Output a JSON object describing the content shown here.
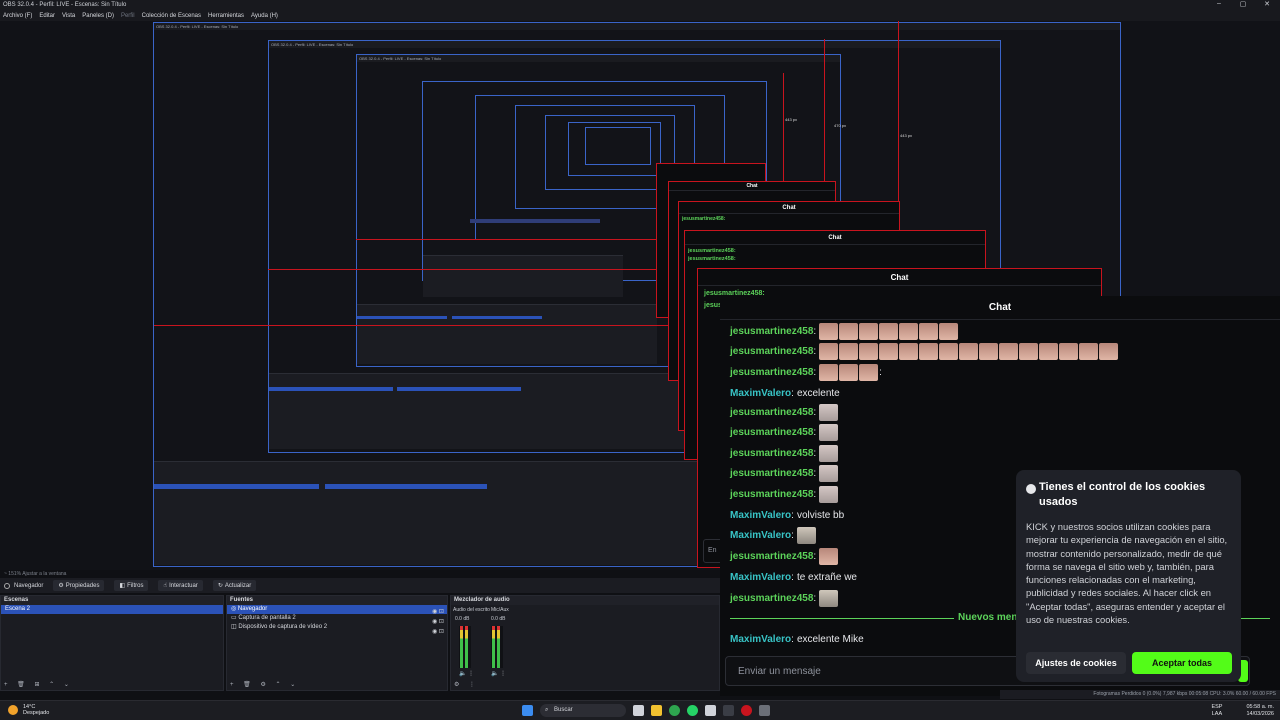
{
  "window": {
    "title": "OBS 32.0.4 - Perfil: LIVE - Escenas: Sin Título",
    "controls": [
      "–",
      "▢",
      "✕"
    ]
  },
  "menu": [
    "Archivo (F)",
    "Editar",
    "Vista",
    "Paneles (D)",
    "Perfil",
    "Colección de Escenas",
    "Herramientas",
    "Ayuda (H)"
  ],
  "preview": {
    "measure_labels": [
      "443 px",
      "470 px",
      "443 px"
    ]
  },
  "chat": {
    "title": "Chat",
    "messages": [
      {
        "user": "jesusmartinez458",
        "sep": ":",
        "emotes": 7,
        "text": ""
      },
      {
        "user": "jesusmartinez458",
        "sep": ":",
        "emotes": 15,
        "text": ""
      },
      {
        "user": "jesusmartinez458",
        "sep": ":",
        "emotes": 3,
        "text": ":"
      },
      {
        "user": "MaximValero",
        "sep": ":",
        "emotes": 0,
        "text": "excelente"
      },
      {
        "user": "jesusmartinez458",
        "sep": ":",
        "emotes": 1,
        "text": ""
      },
      {
        "user": "jesusmartinez458",
        "sep": ":",
        "emotes": 1,
        "text": ""
      },
      {
        "user": "jesusmartinez458",
        "sep": ":",
        "emotes": 1,
        "text": ""
      },
      {
        "user": "jesusmartinez458",
        "sep": ":",
        "emotes": 1,
        "text": ""
      },
      {
        "user": "jesusmartinez458",
        "sep": ":",
        "emotes": 1,
        "text": ""
      },
      {
        "user": "MaximValero",
        "sep": ":",
        "emotes": 0,
        "text": "volviste bb"
      },
      {
        "user": "MaximValero",
        "sep": ":",
        "emotes": 1,
        "text": ""
      },
      {
        "user": "jesusmartinez458",
        "sep": ":",
        "emotes": 1,
        "text": ""
      },
      {
        "user": "MaximValero",
        "sep": ":",
        "emotes": 0,
        "text": "te extrañe we"
      },
      {
        "user": "jesusmartinez458",
        "sep": ":",
        "emotes": 1,
        "text": ""
      },
      {
        "user": "MaximValero",
        "sep": ":",
        "emotes": 0,
        "text": "excelente Mike"
      }
    ],
    "new_messages_label": "Nuevos mensaje",
    "input_placeholder": "Enviar un mensaje",
    "small_input_hint": "En"
  },
  "cookie_banner": {
    "title": "Tienes el control de los cookies usados",
    "body": "KICK y nuestros socios utilizan cookies para mejorar tu experiencia de navegación en el sitio, mostrar contenido personalizado, medir de qué forma se navega el sitio web y, también, para funciones relacionadas con el marketing, publicidad y redes sociales. Al hacer click en \"Aceptar todas\", aseguras entender y aceptar el uso de nuestras cookies.",
    "settings_button": "Ajustes de cookies",
    "accept_button": "Aceptar todas"
  },
  "obs": {
    "status_line": "~  151%   Ajustar a la ventana",
    "toolbar": {
      "source_name": "Navegador",
      "buttons": [
        "Propiedades",
        "Filtros",
        "Interactuar",
        "Actualizar"
      ]
    },
    "scenes": {
      "title": "Escenas",
      "items": [
        "Escena 2"
      ]
    },
    "sources": {
      "title": "Fuentes",
      "items": [
        "Navegador",
        "Captura de pantalla 2",
        "Dispositivo de captura de vídeo 2"
      ]
    },
    "mixer": {
      "title": "Mezclador de audio",
      "channels": [
        {
          "name": "Audio del escrito",
          "level": "0.0 dB"
        },
        {
          "name": "Mic/Aux",
          "level": "0.0 dB"
        }
      ]
    },
    "statusbar": "Fotogramas Perdidos 0 (0.0%)   7,987 kbps   00:05:08   CPU: 3.0%   60.00 / 60.00 FPS"
  },
  "taskbar": {
    "weather": {
      "temp": "14°C",
      "desc": "Despejado"
    },
    "search": "Buscar",
    "lang": [
      "ESP",
      "LAA"
    ],
    "time": "05:58 a. m.",
    "date": "14/03/2026"
  },
  "colors": {
    "kick_green": "#53fc18",
    "user_green": "#5cd35a",
    "user_teal": "#38c4c6",
    "obs_select": "#2b52b8",
    "red_outline": "#c8141e"
  }
}
